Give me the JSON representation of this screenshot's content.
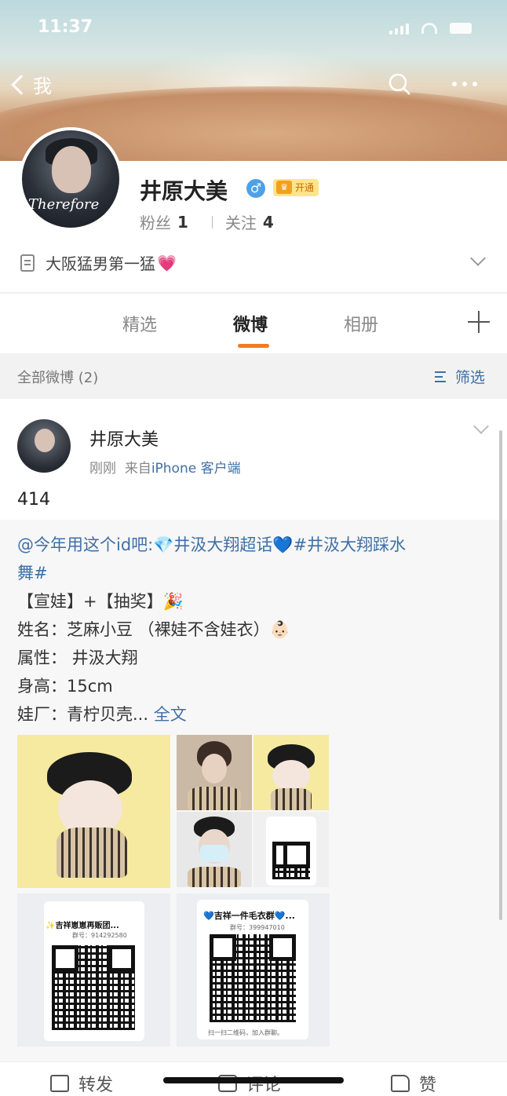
{
  "status_bar": {
    "time": "11:37",
    "location_icon": "location-arrow-icon",
    "icons": [
      "signal-icon",
      "wifi-icon",
      "battery-icon"
    ]
  },
  "nav": {
    "back_label": "我",
    "search_icon": "search-icon",
    "more_icon": "more-icon"
  },
  "profile": {
    "name": "井原大美",
    "gender_icon": "male-icon",
    "vip_label": "开通",
    "followers_label": "粉丝",
    "followers": "1",
    "following_label": "关注",
    "following": "4",
    "bio": "大阪猛男第一猛",
    "bio_emoji": "💗",
    "avatar_text": "Therefore"
  },
  "tabs": [
    {
      "label": "精选"
    },
    {
      "label": "微博",
      "active": true
    },
    {
      "label": "相册"
    }
  ],
  "filter": {
    "count_label": "全部微博 (2)",
    "button_label": "筛选"
  },
  "post": {
    "author": "井原大美",
    "time": "刚刚",
    "source_prefix": "来自",
    "source": "iPhone 客户端",
    "text": "414",
    "repost": {
      "line1_mention": "@今年用这个id吧:",
      "line1_topic": "💎井汲大翔超话💙#井汲大翔踩水",
      "line2": "舞#",
      "line3": "【宣娃】+【抽奖】🎉",
      "line4": "姓名：芝麻小豆 （裸娃不含娃衣）👶🏻",
      "line5": "属性： 井汲大翔",
      "line6": "身高：15cm",
      "line7": "娃厂：青柠贝壳...",
      "full_text_label": "全文"
    },
    "images": {
      "qr1_title": "✨吉祥崽崽再贩团...",
      "qr1_group": "群号：914292580",
      "qr2_title": "💙吉祥一件毛衣群💙...",
      "qr2_group": "群号：399947010",
      "qr2_hint": "扫一扫二维码，加入群聊。"
    }
  },
  "actions": {
    "repost": "转发",
    "comment": "评论",
    "like": "赞"
  },
  "colors": {
    "accent": "#f27c21",
    "link": "#3f6fa6"
  }
}
